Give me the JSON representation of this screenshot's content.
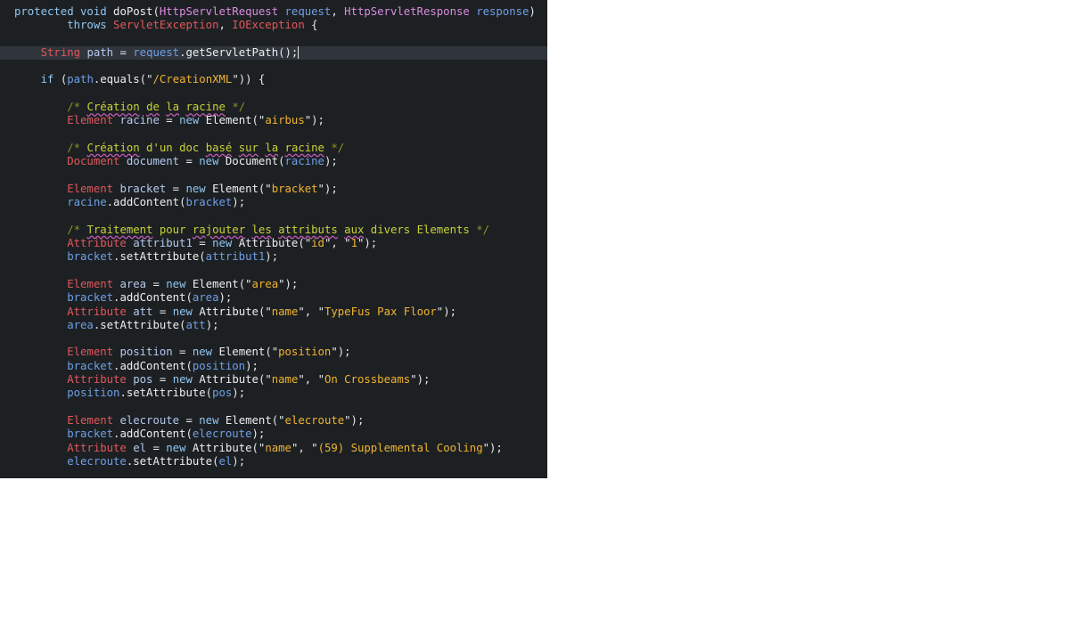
{
  "editor": {
    "theme": {
      "background": "#1d2023",
      "active_line": "#30353b",
      "keyword": "#8fc6f2",
      "type": "#e0575b",
      "string": "#f0b330",
      "comment": "#c9d235"
    },
    "cursor_line": 4,
    "lines": [
      [
        [
          "kw",
          "protected"
        ],
        [
          "pu",
          " "
        ],
        [
          "kw",
          "void"
        ],
        [
          "pu",
          " "
        ],
        [
          "fn",
          "doPost"
        ],
        [
          "pu",
          "("
        ],
        [
          "pt",
          "HttpServletRequest"
        ],
        [
          "pu",
          " "
        ],
        [
          "ref",
          "request"
        ],
        [
          "pu",
          ", "
        ],
        [
          "pt",
          "HttpServletResponse"
        ],
        [
          "pu",
          " "
        ],
        [
          "ref",
          "response"
        ],
        [
          "pu",
          ")"
        ]
      ],
      [
        [
          "pu",
          "        "
        ],
        [
          "kw",
          "throws"
        ],
        [
          "pu",
          " "
        ],
        [
          "ty",
          "ServletException"
        ],
        [
          "pu",
          ", "
        ],
        [
          "ty",
          "IOException"
        ],
        [
          "pu",
          " {"
        ]
      ],
      [],
      [
        [
          "pu",
          "    "
        ],
        [
          "ty",
          "String"
        ],
        [
          "pu",
          " "
        ],
        [
          "decl",
          "path"
        ],
        [
          "pu",
          " = "
        ],
        [
          "ref",
          "request"
        ],
        [
          "pu",
          "."
        ],
        [
          "fn",
          "getServletPath"
        ],
        [
          "pu",
          "();"
        ]
      ],
      [],
      [
        [
          "pu",
          "    "
        ],
        [
          "kw",
          "if"
        ],
        [
          "pu",
          " ("
        ],
        [
          "ref",
          "path"
        ],
        [
          "pu",
          "."
        ],
        [
          "fn",
          "equals"
        ],
        [
          "pu",
          "(\""
        ],
        [
          "st",
          "/CreationXML"
        ],
        [
          "pu",
          "\")) {"
        ]
      ],
      [],
      [
        [
          "pu",
          "        "
        ],
        [
          "cmd",
          "/*"
        ],
        [
          "cm",
          " "
        ],
        [
          "cms",
          "Création"
        ],
        [
          "cm",
          " "
        ],
        [
          "cms",
          "de"
        ],
        [
          "cm",
          " "
        ],
        [
          "cms",
          "la"
        ],
        [
          "cm",
          " "
        ],
        [
          "cms",
          "racine"
        ],
        [
          "cm",
          " "
        ],
        [
          "cmd",
          "*/"
        ]
      ],
      [
        [
          "pu",
          "        "
        ],
        [
          "ty",
          "Element"
        ],
        [
          "pu",
          " "
        ],
        [
          "decl",
          "racine"
        ],
        [
          "pu",
          " = "
        ],
        [
          "kw",
          "new"
        ],
        [
          "pu",
          " "
        ],
        [
          "fn",
          "Element"
        ],
        [
          "pu",
          "(\""
        ],
        [
          "st",
          "airbus"
        ],
        [
          "pu",
          "\");"
        ]
      ],
      [],
      [
        [
          "pu",
          "        "
        ],
        [
          "cmd",
          "/*"
        ],
        [
          "cm",
          " "
        ],
        [
          "cms",
          "Création"
        ],
        [
          "cm",
          " d'un doc "
        ],
        [
          "cms",
          "basé"
        ],
        [
          "cm",
          " "
        ],
        [
          "cms",
          "sur"
        ],
        [
          "cm",
          " "
        ],
        [
          "cms",
          "la"
        ],
        [
          "cm",
          " "
        ],
        [
          "cms",
          "racine"
        ],
        [
          "cm",
          " "
        ],
        [
          "cmd",
          "*/"
        ]
      ],
      [
        [
          "pu",
          "        "
        ],
        [
          "ty",
          "Document"
        ],
        [
          "pu",
          " "
        ],
        [
          "decl",
          "document"
        ],
        [
          "pu",
          " = "
        ],
        [
          "kw",
          "new"
        ],
        [
          "pu",
          " "
        ],
        [
          "fn",
          "Document"
        ],
        [
          "pu",
          "("
        ],
        [
          "ref",
          "racine"
        ],
        [
          "pu",
          ");"
        ]
      ],
      [],
      [
        [
          "pu",
          "        "
        ],
        [
          "ty",
          "Element"
        ],
        [
          "pu",
          " "
        ],
        [
          "decl",
          "bracket"
        ],
        [
          "pu",
          " = "
        ],
        [
          "kw",
          "new"
        ],
        [
          "pu",
          " "
        ],
        [
          "fn",
          "Element"
        ],
        [
          "pu",
          "(\""
        ],
        [
          "st",
          "bracket"
        ],
        [
          "pu",
          "\");"
        ]
      ],
      [
        [
          "pu",
          "        "
        ],
        [
          "ref",
          "racine"
        ],
        [
          "pu",
          "."
        ],
        [
          "fn",
          "addContent"
        ],
        [
          "pu",
          "("
        ],
        [
          "ref",
          "bracket"
        ],
        [
          "pu",
          ");"
        ]
      ],
      [],
      [
        [
          "pu",
          "        "
        ],
        [
          "cmd",
          "/*"
        ],
        [
          "cm",
          " "
        ],
        [
          "cms",
          "Traitement"
        ],
        [
          "cm",
          " pour "
        ],
        [
          "cms",
          "rajouter"
        ],
        [
          "cm",
          " "
        ],
        [
          "cms",
          "les"
        ],
        [
          "cm",
          " "
        ],
        [
          "cms",
          "attributs"
        ],
        [
          "cm",
          " "
        ],
        [
          "cms",
          "aux"
        ],
        [
          "cm",
          " divers Elements "
        ],
        [
          "cmd",
          "*/"
        ]
      ],
      [
        [
          "pu",
          "        "
        ],
        [
          "ty",
          "Attribute"
        ],
        [
          "pu",
          " "
        ],
        [
          "decl",
          "attribut1"
        ],
        [
          "pu",
          " = "
        ],
        [
          "kw",
          "new"
        ],
        [
          "pu",
          " "
        ],
        [
          "fn",
          "Attribute"
        ],
        [
          "pu",
          "(\""
        ],
        [
          "st",
          "id"
        ],
        [
          "pu",
          "\", \""
        ],
        [
          "st",
          "1"
        ],
        [
          "pu",
          "\");"
        ]
      ],
      [
        [
          "pu",
          "        "
        ],
        [
          "ref",
          "bracket"
        ],
        [
          "pu",
          "."
        ],
        [
          "fn",
          "setAttribute"
        ],
        [
          "pu",
          "("
        ],
        [
          "ref",
          "attribut1"
        ],
        [
          "pu",
          ");"
        ]
      ],
      [],
      [
        [
          "pu",
          "        "
        ],
        [
          "ty",
          "Element"
        ],
        [
          "pu",
          " "
        ],
        [
          "decl",
          "area"
        ],
        [
          "pu",
          " = "
        ],
        [
          "kw",
          "new"
        ],
        [
          "pu",
          " "
        ],
        [
          "fn",
          "Element"
        ],
        [
          "pu",
          "(\""
        ],
        [
          "st",
          "area"
        ],
        [
          "pu",
          "\");"
        ]
      ],
      [
        [
          "pu",
          "        "
        ],
        [
          "ref",
          "bracket"
        ],
        [
          "pu",
          "."
        ],
        [
          "fn",
          "addContent"
        ],
        [
          "pu",
          "("
        ],
        [
          "ref",
          "area"
        ],
        [
          "pu",
          ");"
        ]
      ],
      [
        [
          "pu",
          "        "
        ],
        [
          "ty",
          "Attribute"
        ],
        [
          "pu",
          " "
        ],
        [
          "decl",
          "att"
        ],
        [
          "pu",
          " = "
        ],
        [
          "kw",
          "new"
        ],
        [
          "pu",
          " "
        ],
        [
          "fn",
          "Attribute"
        ],
        [
          "pu",
          "(\""
        ],
        [
          "st",
          "name"
        ],
        [
          "pu",
          "\", \""
        ],
        [
          "st",
          "TypeFus Pax Floor"
        ],
        [
          "pu",
          "\");"
        ]
      ],
      [
        [
          "pu",
          "        "
        ],
        [
          "ref",
          "area"
        ],
        [
          "pu",
          "."
        ],
        [
          "fn",
          "setAttribute"
        ],
        [
          "pu",
          "("
        ],
        [
          "ref",
          "att"
        ],
        [
          "pu",
          ");"
        ]
      ],
      [],
      [
        [
          "pu",
          "        "
        ],
        [
          "ty",
          "Element"
        ],
        [
          "pu",
          " "
        ],
        [
          "decl",
          "position"
        ],
        [
          "pu",
          " = "
        ],
        [
          "kw",
          "new"
        ],
        [
          "pu",
          " "
        ],
        [
          "fn",
          "Element"
        ],
        [
          "pu",
          "(\""
        ],
        [
          "st",
          "position"
        ],
        [
          "pu",
          "\");"
        ]
      ],
      [
        [
          "pu",
          "        "
        ],
        [
          "ref",
          "bracket"
        ],
        [
          "pu",
          "."
        ],
        [
          "fn",
          "addContent"
        ],
        [
          "pu",
          "("
        ],
        [
          "ref",
          "position"
        ],
        [
          "pu",
          ");"
        ]
      ],
      [
        [
          "pu",
          "        "
        ],
        [
          "ty",
          "Attribute"
        ],
        [
          "pu",
          " "
        ],
        [
          "decl",
          "pos"
        ],
        [
          "pu",
          " = "
        ],
        [
          "kw",
          "new"
        ],
        [
          "pu",
          " "
        ],
        [
          "fn",
          "Attribute"
        ],
        [
          "pu",
          "(\""
        ],
        [
          "st",
          "name"
        ],
        [
          "pu",
          "\", \""
        ],
        [
          "st",
          "On Crossbeams"
        ],
        [
          "pu",
          "\");"
        ]
      ],
      [
        [
          "pu",
          "        "
        ],
        [
          "ref",
          "position"
        ],
        [
          "pu",
          "."
        ],
        [
          "fn",
          "setAttribute"
        ],
        [
          "pu",
          "("
        ],
        [
          "ref",
          "pos"
        ],
        [
          "pu",
          ");"
        ]
      ],
      [],
      [
        [
          "pu",
          "        "
        ],
        [
          "ty",
          "Element"
        ],
        [
          "pu",
          " "
        ],
        [
          "decl",
          "elecroute"
        ],
        [
          "pu",
          " = "
        ],
        [
          "kw",
          "new"
        ],
        [
          "pu",
          " "
        ],
        [
          "fn",
          "Element"
        ],
        [
          "pu",
          "(\""
        ],
        [
          "st",
          "elecroute"
        ],
        [
          "pu",
          "\");"
        ]
      ],
      [
        [
          "pu",
          "        "
        ],
        [
          "ref",
          "bracket"
        ],
        [
          "pu",
          "."
        ],
        [
          "fn",
          "addContent"
        ],
        [
          "pu",
          "("
        ],
        [
          "ref",
          "elecroute"
        ],
        [
          "pu",
          ");"
        ]
      ],
      [
        [
          "pu",
          "        "
        ],
        [
          "ty",
          "Attribute"
        ],
        [
          "pu",
          " "
        ],
        [
          "decl",
          "el"
        ],
        [
          "pu",
          " = "
        ],
        [
          "kw",
          "new"
        ],
        [
          "pu",
          " "
        ],
        [
          "fn",
          "Attribute"
        ],
        [
          "pu",
          "(\""
        ],
        [
          "st",
          "name"
        ],
        [
          "pu",
          "\", \""
        ],
        [
          "st",
          "(59) Supplemental Cooling"
        ],
        [
          "pu",
          "\");"
        ]
      ],
      [
        [
          "pu",
          "        "
        ],
        [
          "ref",
          "elecroute"
        ],
        [
          "pu",
          "."
        ],
        [
          "fn",
          "setAttribute"
        ],
        [
          "pu",
          "("
        ],
        [
          "ref",
          "el"
        ],
        [
          "pu",
          ");"
        ]
      ]
    ]
  }
}
